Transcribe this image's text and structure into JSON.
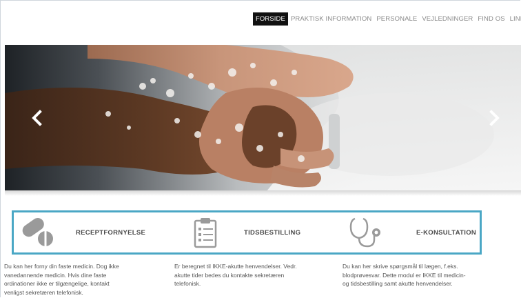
{
  "nav": {
    "items": [
      {
        "label": "FORSIDE",
        "active": true
      },
      {
        "label": "PRAKTISK INFORMATION",
        "active": false
      },
      {
        "label": "PERSONALE",
        "active": false
      },
      {
        "label": "VEJLEDNINGER",
        "active": false
      },
      {
        "label": "FIND OS",
        "active": false
      },
      {
        "label": "LINKS",
        "active": false
      }
    ]
  },
  "slider": {
    "image": "hand-washing-photo",
    "prev_icon": "chevron-left-icon",
    "next_icon": "chevron-right-icon"
  },
  "services": [
    {
      "icon": "pills-icon",
      "title": "RECEPTFORNYELSE",
      "description_lines": [
        "Du kan her forny din faste medicin. Dog ikke",
        "vanedannende medicin. Hvis dine faste",
        "ordinationer ikke er tilgængelige, kontakt",
        "venligst sekretæren telefonisk."
      ]
    },
    {
      "icon": "clipboard-icon",
      "title": "TIDSBESTILLING",
      "description_lines": [
        "Er beregnet til IKKE-akutte henvendelser. Vedr.",
        "akutte tider bedes du kontakte sekretæren",
        "telefonisk."
      ]
    },
    {
      "icon": "stethoscope-icon",
      "title": "E-KONSULTATION",
      "description_lines": [
        "Du kan her skrive spørgsmål til lægen, f.eks.",
        "blodprøvesvar. Dette modul er IKKE til medicin-",
        "og tidsbestilling samt akutte henvendelser."
      ]
    }
  ],
  "colors": {
    "accent_border": "#4aa7c5",
    "nav_active_bg": "#111111",
    "icon_gray": "#9a9a9a"
  }
}
